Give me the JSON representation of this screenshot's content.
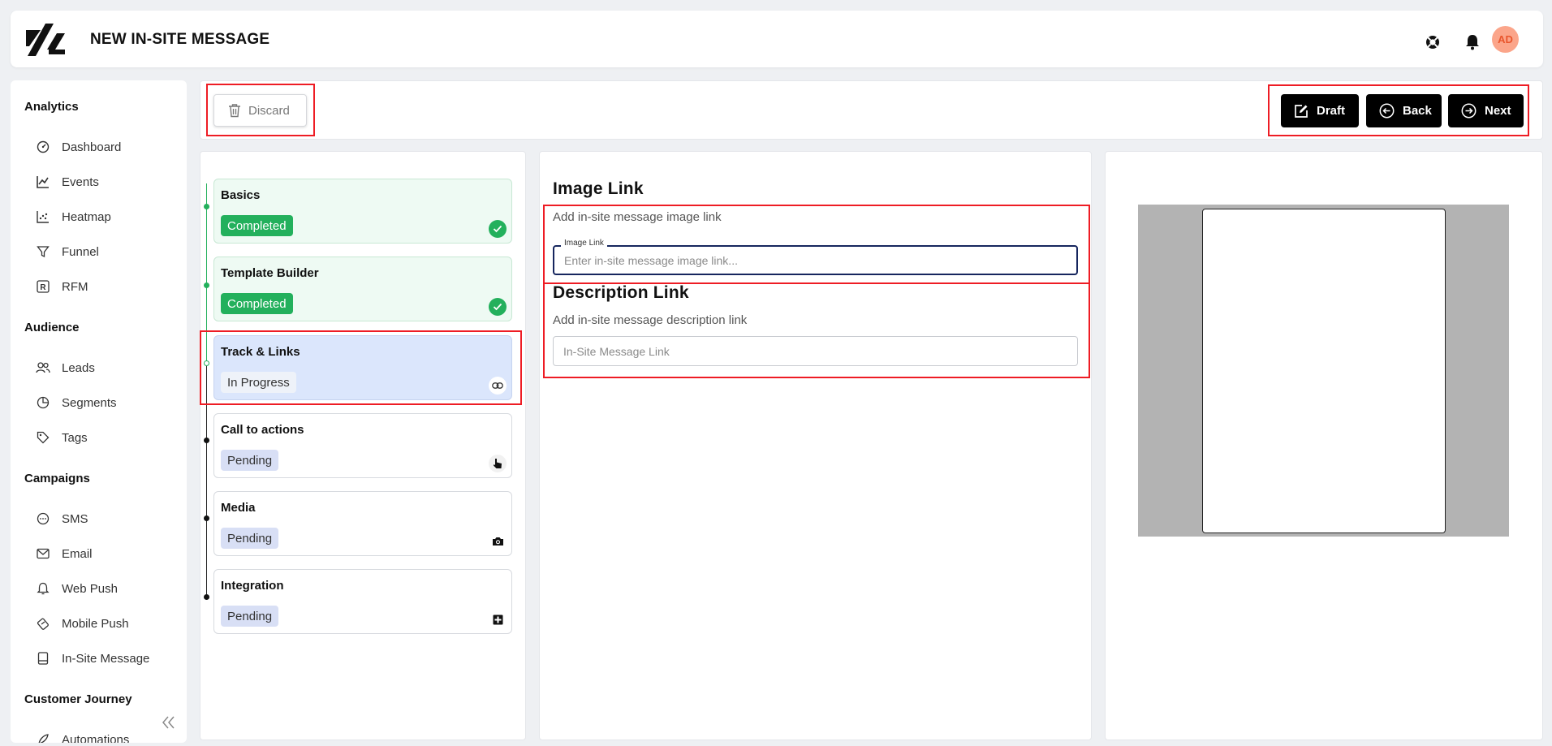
{
  "header": {
    "title": "NEW IN-SITE MESSAGE",
    "avatar_initials": "AD"
  },
  "sidebar": {
    "sections": [
      {
        "label": "Analytics",
        "items": [
          "Dashboard",
          "Events",
          "Heatmap",
          "Funnel",
          "RFM"
        ]
      },
      {
        "label": "Audience",
        "items": [
          "Leads",
          "Segments",
          "Tags"
        ]
      },
      {
        "label": "Campaigns",
        "items": [
          "SMS",
          "Email",
          "Web Push",
          "Mobile Push",
          "In-Site Message"
        ]
      },
      {
        "label": "Customer Journey",
        "items": [
          "Automations"
        ]
      }
    ]
  },
  "toolbar": {
    "discard_label": "Discard",
    "draft_label": "Draft",
    "back_label": "Back",
    "next_label": "Next"
  },
  "steps": [
    {
      "title": "Basics",
      "status": "Completed",
      "icon": "check-icon"
    },
    {
      "title": "Template Builder",
      "status": "Completed",
      "icon": "check-icon"
    },
    {
      "title": "Track & Links",
      "status": "In Progress",
      "icon": "link-icon"
    },
    {
      "title": "Call to actions",
      "status": "Pending",
      "icon": "pointer-icon"
    },
    {
      "title": "Media",
      "status": "Pending",
      "icon": "camera-icon"
    },
    {
      "title": "Integration",
      "status": "Pending",
      "icon": "integration-icon"
    }
  ],
  "form": {
    "image_link": {
      "title": "Image Link",
      "description": "Add in-site message image link",
      "label": "Image Link",
      "placeholder": "Enter in-site message image link...",
      "value": ""
    },
    "description_link": {
      "title": "Description Link",
      "description": "Add in-site message description link",
      "placeholder": "In-Site Message Link",
      "value": ""
    }
  },
  "colors": {
    "completed": "#23b05c",
    "in_progress_bg": "#dbe6fc",
    "pending_badge": "#d8dff5",
    "highlight": "#ee1c24",
    "primary_button": "#000000",
    "avatar_bg": "#fba58a"
  }
}
